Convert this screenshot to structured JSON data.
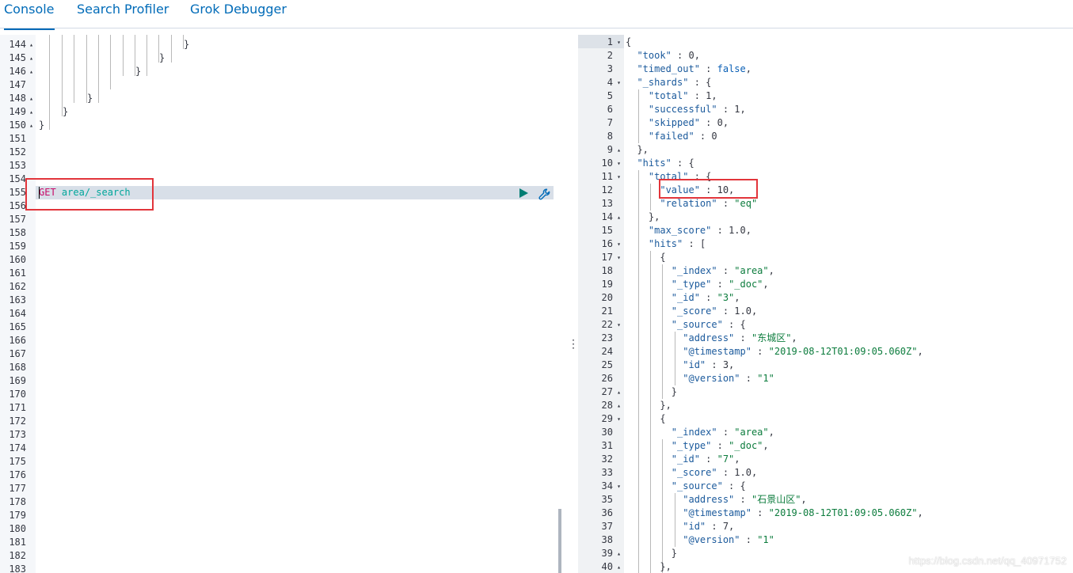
{
  "tabs": [
    {
      "label": "Console",
      "active": true
    },
    {
      "label": "Search Profiler",
      "active": false
    },
    {
      "label": "Grok Debugger",
      "active": false
    }
  ],
  "request": {
    "method": "GET",
    "path": "area/_search"
  },
  "left_gutter": [
    {
      "n": "144",
      "fold": "▴"
    },
    {
      "n": "145",
      "fold": "▴"
    },
    {
      "n": "146",
      "fold": "▴"
    },
    {
      "n": "147",
      "fold": ""
    },
    {
      "n": "148",
      "fold": "▴"
    },
    {
      "n": "149",
      "fold": "▴"
    },
    {
      "n": "150",
      "fold": "▴"
    },
    {
      "n": "151",
      "fold": ""
    },
    {
      "n": "152",
      "fold": ""
    },
    {
      "n": "153",
      "fold": ""
    },
    {
      "n": "154",
      "fold": ""
    },
    {
      "n": "155",
      "fold": ""
    },
    {
      "n": "156",
      "fold": ""
    },
    {
      "n": "157",
      "fold": ""
    },
    {
      "n": "158",
      "fold": ""
    },
    {
      "n": "159",
      "fold": ""
    },
    {
      "n": "160",
      "fold": ""
    },
    {
      "n": "161",
      "fold": ""
    },
    {
      "n": "162",
      "fold": ""
    },
    {
      "n": "163",
      "fold": ""
    },
    {
      "n": "164",
      "fold": ""
    },
    {
      "n": "165",
      "fold": ""
    },
    {
      "n": "166",
      "fold": ""
    },
    {
      "n": "167",
      "fold": ""
    },
    {
      "n": "168",
      "fold": ""
    },
    {
      "n": "169",
      "fold": ""
    },
    {
      "n": "170",
      "fold": ""
    },
    {
      "n": "171",
      "fold": ""
    },
    {
      "n": "172",
      "fold": ""
    },
    {
      "n": "173",
      "fold": ""
    },
    {
      "n": "174",
      "fold": ""
    },
    {
      "n": "175",
      "fold": ""
    },
    {
      "n": "176",
      "fold": ""
    },
    {
      "n": "177",
      "fold": ""
    },
    {
      "n": "178",
      "fold": ""
    },
    {
      "n": "179",
      "fold": ""
    },
    {
      "n": "180",
      "fold": ""
    },
    {
      "n": "181",
      "fold": ""
    },
    {
      "n": "182",
      "fold": ""
    },
    {
      "n": "183",
      "fold": ""
    }
  ],
  "left_braces": {
    "b144": "}",
    "b145": "}",
    "b146": "}",
    "b148": "}",
    "b149": "}",
    "b150": "}"
  },
  "response_lines": [
    {
      "n": "1",
      "fold": "▾",
      "parts": [
        [
          "n",
          "{"
        ]
      ]
    },
    {
      "n": "2",
      "fold": "",
      "parts": [
        [
          "n",
          "  "
        ],
        [
          "k",
          "\"took\""
        ],
        [
          "n",
          " : 0,"
        ]
      ]
    },
    {
      "n": "3",
      "fold": "",
      "parts": [
        [
          "n",
          "  "
        ],
        [
          "k",
          "\"timed_out\""
        ],
        [
          "n",
          " : "
        ],
        [
          "b",
          "false"
        ],
        [
          "n",
          ","
        ]
      ]
    },
    {
      "n": "4",
      "fold": "▾",
      "parts": [
        [
          "n",
          "  "
        ],
        [
          "k",
          "\"_shards\""
        ],
        [
          "n",
          " : {"
        ]
      ]
    },
    {
      "n": "5",
      "fold": "",
      "parts": [
        [
          "n",
          "    "
        ],
        [
          "k",
          "\"total\""
        ],
        [
          "n",
          " : 1,"
        ]
      ]
    },
    {
      "n": "6",
      "fold": "",
      "parts": [
        [
          "n",
          "    "
        ],
        [
          "k",
          "\"successful\""
        ],
        [
          "n",
          " : 1,"
        ]
      ]
    },
    {
      "n": "7",
      "fold": "",
      "parts": [
        [
          "n",
          "    "
        ],
        [
          "k",
          "\"skipped\""
        ],
        [
          "n",
          " : 0,"
        ]
      ]
    },
    {
      "n": "8",
      "fold": "",
      "parts": [
        [
          "n",
          "    "
        ],
        [
          "k",
          "\"failed\""
        ],
        [
          "n",
          " : 0"
        ]
      ]
    },
    {
      "n": "9",
      "fold": "▴",
      "parts": [
        [
          "n",
          "  },"
        ]
      ]
    },
    {
      "n": "10",
      "fold": "▾",
      "parts": [
        [
          "n",
          "  "
        ],
        [
          "k",
          "\"hits\""
        ],
        [
          "n",
          " : {"
        ]
      ]
    },
    {
      "n": "11",
      "fold": "▾",
      "parts": [
        [
          "n",
          "    "
        ],
        [
          "k",
          "\"total\""
        ],
        [
          "n",
          " : {"
        ]
      ]
    },
    {
      "n": "12",
      "fold": "",
      "parts": [
        [
          "n",
          "      "
        ],
        [
          "k",
          "\"value\""
        ],
        [
          "n",
          " : 10,"
        ]
      ]
    },
    {
      "n": "13",
      "fold": "",
      "parts": [
        [
          "n",
          "      "
        ],
        [
          "k",
          "\"relation\""
        ],
        [
          "n",
          " : "
        ],
        [
          "s",
          "\"eq\""
        ]
      ]
    },
    {
      "n": "14",
      "fold": "▴",
      "parts": [
        [
          "n",
          "    },"
        ]
      ]
    },
    {
      "n": "15",
      "fold": "",
      "parts": [
        [
          "n",
          "    "
        ],
        [
          "k",
          "\"max_score\""
        ],
        [
          "n",
          " : 1.0,"
        ]
      ]
    },
    {
      "n": "16",
      "fold": "▾",
      "parts": [
        [
          "n",
          "    "
        ],
        [
          "k",
          "\"hits\""
        ],
        [
          "n",
          " : ["
        ]
      ]
    },
    {
      "n": "17",
      "fold": "▾",
      "parts": [
        [
          "n",
          "      {"
        ]
      ]
    },
    {
      "n": "18",
      "fold": "",
      "parts": [
        [
          "n",
          "        "
        ],
        [
          "k",
          "\"_index\""
        ],
        [
          "n",
          " : "
        ],
        [
          "s",
          "\"area\""
        ],
        [
          "n",
          ","
        ]
      ]
    },
    {
      "n": "19",
      "fold": "",
      "parts": [
        [
          "n",
          "        "
        ],
        [
          "k",
          "\"_type\""
        ],
        [
          "n",
          " : "
        ],
        [
          "s",
          "\"_doc\""
        ],
        [
          "n",
          ","
        ]
      ]
    },
    {
      "n": "20",
      "fold": "",
      "parts": [
        [
          "n",
          "        "
        ],
        [
          "k",
          "\"_id\""
        ],
        [
          "n",
          " : "
        ],
        [
          "s",
          "\"3\""
        ],
        [
          "n",
          ","
        ]
      ]
    },
    {
      "n": "21",
      "fold": "",
      "parts": [
        [
          "n",
          "        "
        ],
        [
          "k",
          "\"_score\""
        ],
        [
          "n",
          " : 1.0,"
        ]
      ]
    },
    {
      "n": "22",
      "fold": "▾",
      "parts": [
        [
          "n",
          "        "
        ],
        [
          "k",
          "\"_source\""
        ],
        [
          "n",
          " : {"
        ]
      ]
    },
    {
      "n": "23",
      "fold": "",
      "parts": [
        [
          "n",
          "          "
        ],
        [
          "k",
          "\"address\""
        ],
        [
          "n",
          " : "
        ],
        [
          "s",
          "\"东城区\""
        ],
        [
          "n",
          ","
        ]
      ]
    },
    {
      "n": "24",
      "fold": "",
      "parts": [
        [
          "n",
          "          "
        ],
        [
          "k",
          "\"@timestamp\""
        ],
        [
          "n",
          " : "
        ],
        [
          "s",
          "\"2019-08-12T01:09:05.060Z\""
        ],
        [
          "n",
          ","
        ]
      ]
    },
    {
      "n": "25",
      "fold": "",
      "parts": [
        [
          "n",
          "          "
        ],
        [
          "k",
          "\"id\""
        ],
        [
          "n",
          " : 3,"
        ]
      ]
    },
    {
      "n": "26",
      "fold": "",
      "parts": [
        [
          "n",
          "          "
        ],
        [
          "k",
          "\"@version\""
        ],
        [
          "n",
          " : "
        ],
        [
          "s",
          "\"1\""
        ]
      ]
    },
    {
      "n": "27",
      "fold": "▴",
      "parts": [
        [
          "n",
          "        }"
        ]
      ]
    },
    {
      "n": "28",
      "fold": "▴",
      "parts": [
        [
          "n",
          "      },"
        ]
      ]
    },
    {
      "n": "29",
      "fold": "▾",
      "parts": [
        [
          "n",
          "      {"
        ]
      ]
    },
    {
      "n": "30",
      "fold": "",
      "parts": [
        [
          "n",
          "        "
        ],
        [
          "k",
          "\"_index\""
        ],
        [
          "n",
          " : "
        ],
        [
          "s",
          "\"area\""
        ],
        [
          "n",
          ","
        ]
      ]
    },
    {
      "n": "31",
      "fold": "",
      "parts": [
        [
          "n",
          "        "
        ],
        [
          "k",
          "\"_type\""
        ],
        [
          "n",
          " : "
        ],
        [
          "s",
          "\"_doc\""
        ],
        [
          "n",
          ","
        ]
      ]
    },
    {
      "n": "32",
      "fold": "",
      "parts": [
        [
          "n",
          "        "
        ],
        [
          "k",
          "\"_id\""
        ],
        [
          "n",
          " : "
        ],
        [
          "s",
          "\"7\""
        ],
        [
          "n",
          ","
        ]
      ]
    },
    {
      "n": "33",
      "fold": "",
      "parts": [
        [
          "n",
          "        "
        ],
        [
          "k",
          "\"_score\""
        ],
        [
          "n",
          " : 1.0,"
        ]
      ]
    },
    {
      "n": "34",
      "fold": "▾",
      "parts": [
        [
          "n",
          "        "
        ],
        [
          "k",
          "\"_source\""
        ],
        [
          "n",
          " : {"
        ]
      ]
    },
    {
      "n": "35",
      "fold": "",
      "parts": [
        [
          "n",
          "          "
        ],
        [
          "k",
          "\"address\""
        ],
        [
          "n",
          " : "
        ],
        [
          "s",
          "\"石景山区\""
        ],
        [
          "n",
          ","
        ]
      ]
    },
    {
      "n": "36",
      "fold": "",
      "parts": [
        [
          "n",
          "          "
        ],
        [
          "k",
          "\"@timestamp\""
        ],
        [
          "n",
          " : "
        ],
        [
          "s",
          "\"2019-08-12T01:09:05.060Z\""
        ],
        [
          "n",
          ","
        ]
      ]
    },
    {
      "n": "37",
      "fold": "",
      "parts": [
        [
          "n",
          "          "
        ],
        [
          "k",
          "\"id\""
        ],
        [
          "n",
          " : 7,"
        ]
      ]
    },
    {
      "n": "38",
      "fold": "",
      "parts": [
        [
          "n",
          "          "
        ],
        [
          "k",
          "\"@version\""
        ],
        [
          "n",
          " : "
        ],
        [
          "s",
          "\"1\""
        ]
      ]
    },
    {
      "n": "39",
      "fold": "▴",
      "parts": [
        [
          "n",
          "        }"
        ]
      ]
    },
    {
      "n": "40",
      "fold": "▴",
      "parts": [
        [
          "n",
          "      },"
        ]
      ]
    }
  ],
  "watermark": "https://blog.csdn.net/qq_40971752",
  "icons": {
    "run": "play-icon",
    "settings": "wrench-icon",
    "resize": "drag-handle-icon"
  },
  "colors": {
    "accent": "#006bb8",
    "method": "#c80a68",
    "url": "#00a69b",
    "highlight_box": "#e2353b",
    "play": "#017d73"
  }
}
